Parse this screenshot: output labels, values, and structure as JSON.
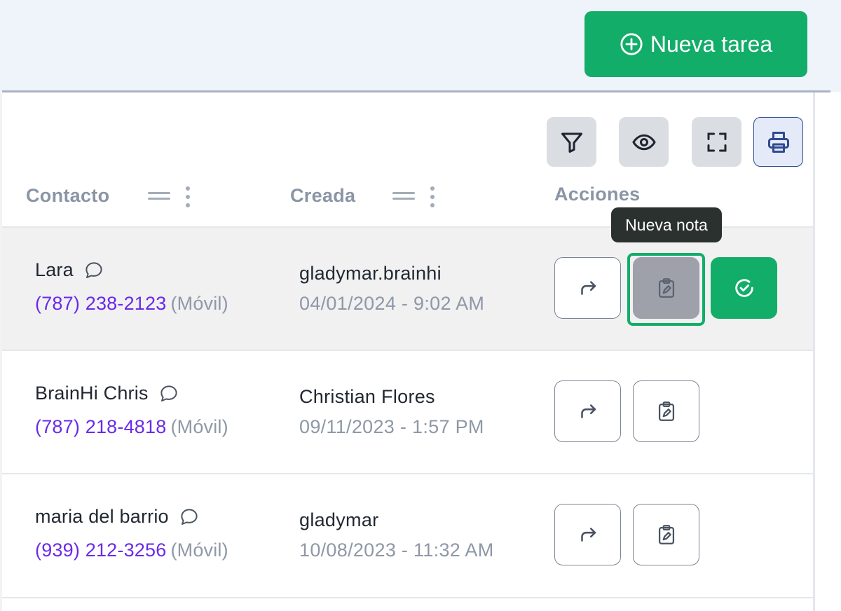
{
  "header": {
    "new_task_label": "Nueva tarea"
  },
  "toolbar": {
    "filter_icon": "filter-icon",
    "visibility_icon": "eye-icon",
    "fullscreen_icon": "fullscreen-icon",
    "print_icon": "printer-icon"
  },
  "table": {
    "columns": [
      {
        "label": "Contacto"
      },
      {
        "label": "Creada"
      },
      {
        "label": "Acciones"
      }
    ],
    "rows": [
      {
        "name": "Lara",
        "phone": "(787) 238-2123",
        "phone_type": "(Móvil)",
        "creator": "gladymar.brainhi",
        "created": "04/01/2024 - 9:02 AM"
      },
      {
        "name": "BrainHi Chris",
        "phone": "(787) 218-4818",
        "phone_type": "(Móvil)",
        "creator": "Christian Flores",
        "created": "09/11/2023 - 1:57 PM"
      },
      {
        "name": "maria del barrio",
        "phone": "(939) 212-3256",
        "phone_type": "(Móvil)",
        "creator": "gladymar",
        "created": "10/08/2023 - 11:32 AM"
      }
    ]
  },
  "tooltip": {
    "text": "Nueva nota"
  },
  "colors": {
    "accent_green": "#13ad6a",
    "phone_purple": "#6a2ae8",
    "muted_gray": "#8e98a6"
  }
}
